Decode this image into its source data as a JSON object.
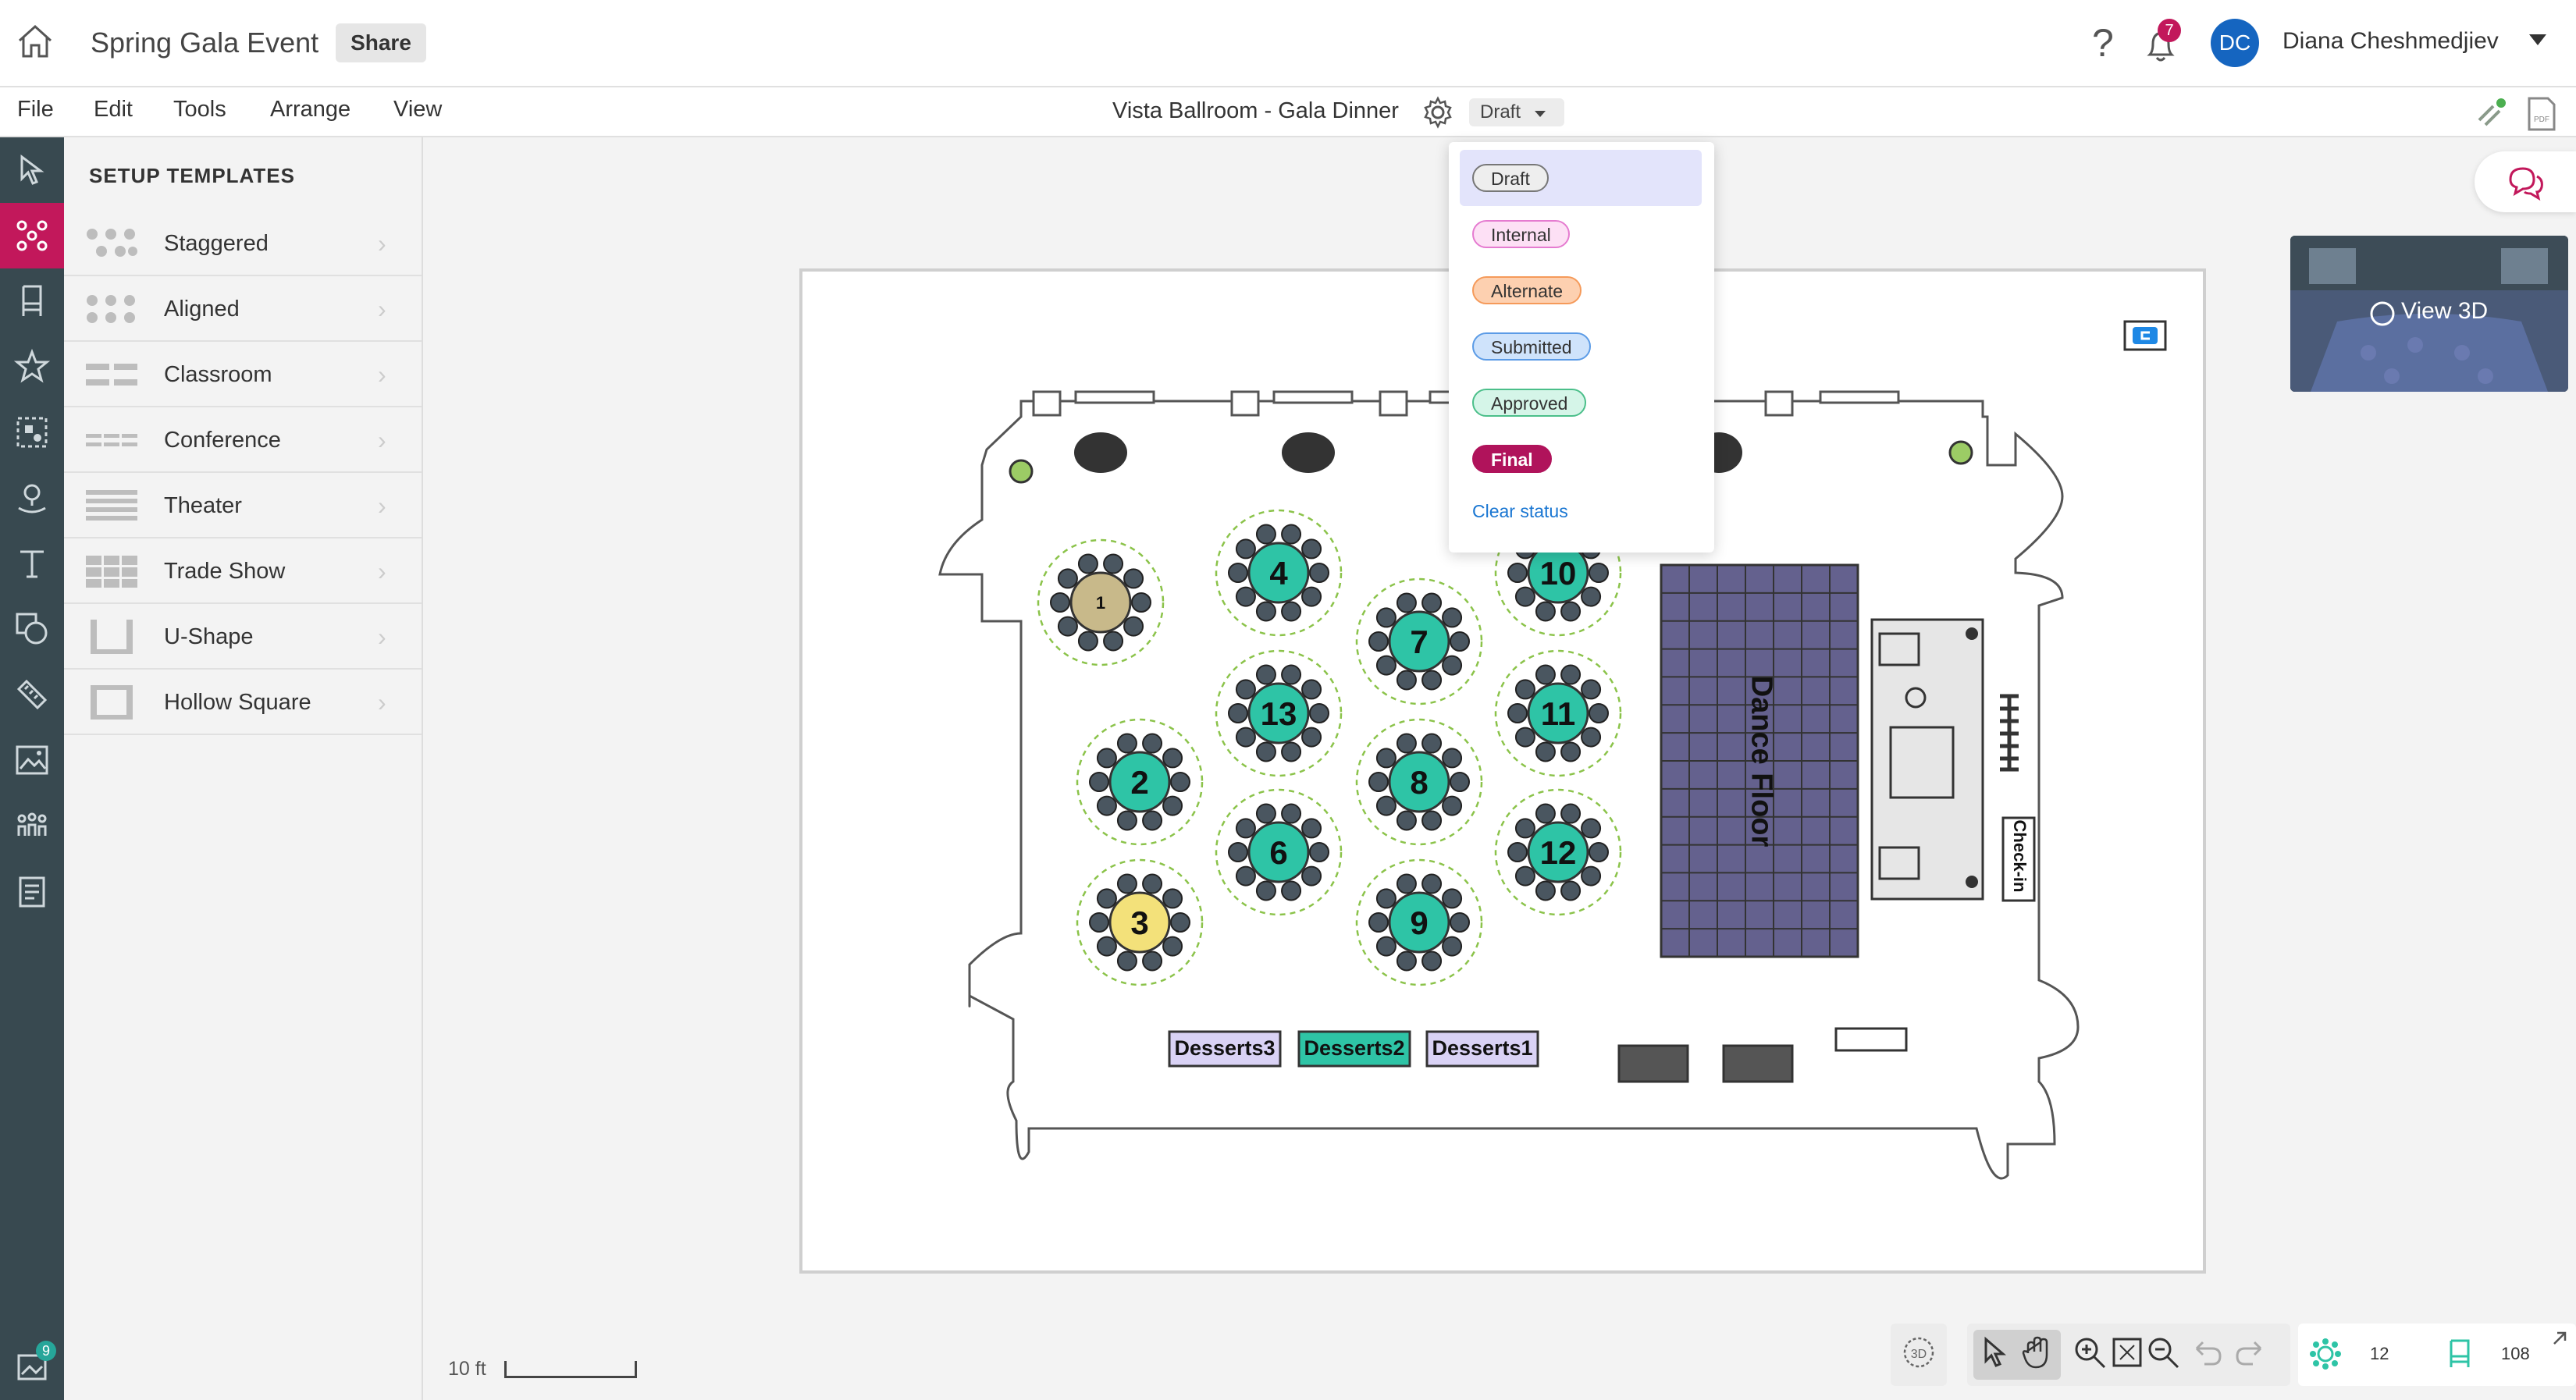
{
  "header": {
    "app_title": "Spring Gala Event",
    "share_label": "Share",
    "help_label": "?",
    "notifications_count": "7",
    "avatar_initials": "DC",
    "user_name": "Diana Cheshmedjiev"
  },
  "menu": {
    "items": [
      "File",
      "Edit",
      "Tools",
      "Arrange",
      "View"
    ],
    "document_title": "Vista Ballroom - Gala Dinner",
    "status_value": "Draft"
  },
  "status_menu": {
    "options": [
      {
        "label": "Draft",
        "bg": "#eeeeee",
        "border": "#777777",
        "color": "#333333"
      },
      {
        "label": "Internal",
        "bg": "#fde0f5",
        "border": "#e57bd0",
        "color": "#333333"
      },
      {
        "label": "Alternate",
        "bg": "#fdd0b0",
        "border": "#f59a5a",
        "color": "#333333"
      },
      {
        "label": "Submitted",
        "bg": "#cfe3fb",
        "border": "#5b9be6",
        "color": "#333333"
      },
      {
        "label": "Approved",
        "bg": "#d5f5e8",
        "border": "#4bbf8a",
        "color": "#333333"
      },
      {
        "label": "Final",
        "bg": "#b0135b",
        "border": "#b0135b",
        "color": "#ffffff"
      }
    ],
    "selected": "Draft",
    "clear_label": "Clear status"
  },
  "left_rail": {
    "icons": [
      "select-icon",
      "setup-templates-icon",
      "chair-icon",
      "star-icon",
      "group-icon",
      "location-pin-icon",
      "text-icon",
      "shapes-icon",
      "ruler-icon",
      "image-icon",
      "people-icon",
      "checklist-icon"
    ],
    "bottom_icon": "gallery-icon",
    "bottom_badge": "9",
    "accent": "#c2185b"
  },
  "sidebar": {
    "heading": "SETUP TEMPLATES",
    "templates": [
      {
        "label": "Staggered",
        "icon": "staggered-icon"
      },
      {
        "label": "Aligned",
        "icon": "aligned-icon"
      },
      {
        "label": "Classroom",
        "icon": "classroom-icon"
      },
      {
        "label": "Conference",
        "icon": "conference-icon"
      },
      {
        "label": "Theater",
        "icon": "theater-icon"
      },
      {
        "label": "Trade Show",
        "icon": "trade-show-icon"
      },
      {
        "label": "U-Shape",
        "icon": "u-shape-icon"
      },
      {
        "label": "Hollow Square",
        "icon": "hollow-square-icon"
      }
    ]
  },
  "floorplan": {
    "tables": [
      {
        "label": "1",
        "color": "#c8b98a"
      },
      {
        "label": "2",
        "color": "#2ec4a6"
      },
      {
        "label": "3",
        "color": "#f3e17a"
      },
      {
        "label": "4",
        "color": "#2ec4a6"
      },
      {
        "label": "13",
        "color": "#2ec4a6"
      },
      {
        "label": "6",
        "color": "#2ec4a6"
      },
      {
        "label": "7",
        "color": "#2ec4a6"
      },
      {
        "label": "8",
        "color": "#2ec4a6"
      },
      {
        "label": "9",
        "color": "#2ec4a6"
      },
      {
        "label": "10",
        "color": "#2ec4a6"
      },
      {
        "label": "11",
        "color": "#2ec4a6"
      },
      {
        "label": "12",
        "color": "#2ec4a6"
      }
    ],
    "dance_floor_label": "Dance Floor",
    "checkin_label": "Check-in",
    "dessert_tables": [
      {
        "label": "Desserts3",
        "color": "#d9d2f5"
      },
      {
        "label": "Desserts2",
        "color": "#2ec4a6"
      },
      {
        "label": "Desserts1",
        "color": "#d9d2f5"
      }
    ]
  },
  "view3d": {
    "label": "View 3D"
  },
  "scale": {
    "label": "10 ft"
  },
  "bottom_toolbar": {
    "three_d_label": "3D",
    "tables_count": "12",
    "chairs_count": "108"
  }
}
